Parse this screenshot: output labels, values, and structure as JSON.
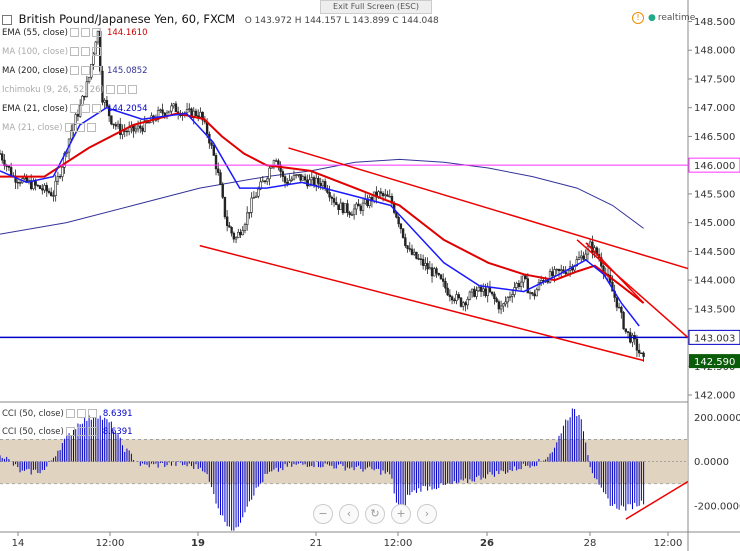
{
  "header": {
    "title": "British Pound/Japanese Yen, 60, FXCM",
    "ohlc": "O 143.972  H 144.157  L 143.899  C 144.048",
    "exit_label": "Exit Full Screen (ESC)",
    "realtime_label": "realtime"
  },
  "indicators": [
    {
      "label": "EMA (55, close)",
      "value": "144.1610",
      "color": "#cc0000"
    },
    {
      "label": "MA (100, close)",
      "value": "",
      "color": "#999999"
    },
    {
      "label": "MA (200, close)",
      "value": "145.0852",
      "color": "#333399"
    },
    {
      "label": "Ichimoku (9, 26, 52, 26)",
      "value": "",
      "color": "#aaaaaa"
    },
    {
      "label": "EMA (21, close)",
      "value": "144.2054",
      "color": "#0000cc"
    },
    {
      "label": "MA (21, close)",
      "value": "",
      "color": "#aaaaaa"
    }
  ],
  "cci_indicators": [
    {
      "label": "CCI (50, close)",
      "value": "8.6391"
    },
    {
      "label": "CCI (50, close)",
      "value": "8.6391"
    }
  ],
  "colors": {
    "candle": "#222222",
    "ema55": "#e00000",
    "ema21": "#1a1aff",
    "ma200": "#333399",
    "channel": "#ee0000",
    "hline_high": "#ff33ff",
    "hline_low": "#0000cc",
    "last_price_bg": "#0a5c0a",
    "cci": "#0000cc",
    "cci_band": "#d8c9b0"
  },
  "chart_data": [
    {
      "type": "candlestick",
      "ylim": [
        142.0,
        148.7
      ],
      "yticks": [
        "148.500",
        "148.000",
        "147.500",
        "147.000",
        "146.500",
        "146.000",
        "145.500",
        "145.000",
        "144.500",
        "144.000",
        "143.500",
        "143.000",
        "142.500",
        "142.000"
      ],
      "x_labels": [
        "14",
        "12:00",
        "19",
        "21",
        "12:00",
        "26",
        "28",
        "12:00"
      ],
      "price_labels": {
        "high_line": "146.000",
        "low_line": "143.003",
        "last": "142.590"
      },
      "horizontal_lines": [
        146.0,
        143.003
      ],
      "last_price": 142.59,
      "close_path": [
        [
          0,
          146.2
        ],
        [
          3,
          145.8
        ],
        [
          6,
          145.7
        ],
        [
          9,
          145.6
        ],
        [
          12,
          145.5
        ],
        [
          14,
          146.0
        ],
        [
          16,
          146.6
        ],
        [
          18,
          147.0
        ],
        [
          20,
          147.5
        ],
        [
          22,
          148.4
        ],
        [
          23,
          147.2
        ],
        [
          25,
          146.8
        ],
        [
          27,
          146.6
        ],
        [
          30,
          146.6
        ],
        [
          33,
          146.7
        ],
        [
          36,
          146.9
        ],
        [
          39,
          147.0
        ],
        [
          42,
          146.9
        ],
        [
          45,
          146.9
        ],
        [
          47,
          146.5
        ],
        [
          49,
          145.9
        ],
        [
          51,
          145.0
        ],
        [
          53,
          144.7
        ],
        [
          55,
          145.0
        ],
        [
          57,
          145.4
        ],
        [
          60,
          145.8
        ],
        [
          62,
          146.2
        ],
        [
          64,
          145.7
        ],
        [
          67,
          145.8
        ],
        [
          70,
          145.7
        ],
        [
          73,
          145.7
        ],
        [
          76,
          145.3
        ],
        [
          79,
          145.2
        ],
        [
          82,
          145.3
        ],
        [
          85,
          145.5
        ],
        [
          88,
          145.4
        ],
        [
          90,
          145.0
        ],
        [
          92,
          144.5
        ],
        [
          95,
          144.3
        ],
        [
          98,
          144.1
        ],
        [
          101,
          143.8
        ],
        [
          104,
          143.6
        ],
        [
          107,
          143.8
        ],
        [
          110,
          143.8
        ],
        [
          113,
          143.5
        ],
        [
          116,
          143.9
        ],
        [
          118,
          144.0
        ],
        [
          120,
          143.7
        ],
        [
          122,
          144.0
        ],
        [
          125,
          144.1
        ],
        [
          128,
          144.2
        ],
        [
          131,
          144.4
        ],
        [
          133,
          144.6
        ],
        [
          135,
          144.4
        ],
        [
          137,
          144.0
        ],
        [
          139,
          143.6
        ],
        [
          141,
          143.1
        ],
        [
          143,
          142.9
        ],
        [
          145,
          142.59
        ]
      ],
      "ema55": [
        [
          0,
          145.8
        ],
        [
          10,
          145.8
        ],
        [
          20,
          146.3
        ],
        [
          30,
          146.7
        ],
        [
          40,
          146.9
        ],
        [
          46,
          146.8
        ],
        [
          50,
          146.5
        ],
        [
          55,
          146.2
        ],
        [
          60,
          146.0
        ],
        [
          70,
          145.9
        ],
        [
          80,
          145.6
        ],
        [
          90,
          145.3
        ],
        [
          100,
          144.7
        ],
        [
          110,
          144.3
        ],
        [
          118,
          144.1
        ],
        [
          125,
          144.0
        ],
        [
          130,
          144.15
        ],
        [
          134,
          144.25
        ],
        [
          140,
          143.9
        ],
        [
          145,
          143.6
        ]
      ],
      "ema21": [
        [
          0,
          145.9
        ],
        [
          6,
          145.7
        ],
        [
          12,
          145.8
        ],
        [
          18,
          146.7
        ],
        [
          24,
          147.0
        ],
        [
          32,
          146.8
        ],
        [
          42,
          146.9
        ],
        [
          48,
          146.4
        ],
        [
          54,
          145.6
        ],
        [
          60,
          145.6
        ],
        [
          68,
          145.7
        ],
        [
          78,
          145.5
        ],
        [
          88,
          145.3
        ],
        [
          94,
          144.8
        ],
        [
          100,
          144.3
        ],
        [
          108,
          143.9
        ],
        [
          118,
          143.8
        ],
        [
          126,
          144.1
        ],
        [
          132,
          144.35
        ],
        [
          136,
          144.1
        ],
        [
          140,
          143.6
        ],
        [
          144,
          143.2
        ]
      ],
      "ma200": [
        [
          0,
          144.8
        ],
        [
          15,
          145.0
        ],
        [
          30,
          145.3
        ],
        [
          45,
          145.6
        ],
        [
          60,
          145.8
        ],
        [
          70,
          145.9
        ],
        [
          80,
          146.05
        ],
        [
          90,
          146.1
        ],
        [
          100,
          146.05
        ],
        [
          110,
          145.95
        ],
        [
          120,
          145.8
        ],
        [
          130,
          145.6
        ],
        [
          138,
          145.3
        ],
        [
          145,
          144.9
        ]
      ],
      "channel_lines": [
        {
          "from": [
            65,
            146.3
          ],
          "to": [
            155,
            144.2
          ]
        },
        {
          "from": [
            45,
            144.6
          ],
          "to": [
            145,
            142.6
          ]
        },
        {
          "from": [
            130,
            144.7
          ],
          "to": [
            155,
            143.0
          ]
        },
        {
          "from": [
            132,
            144.65
          ],
          "to": [
            145,
            143.6
          ]
        }
      ]
    },
    {
      "type": "bar",
      "name": "CCI (50, close)",
      "ylim": [
        -300,
        260
      ],
      "yticks": [
        "200.0000",
        "0.0000",
        "-200.0000"
      ],
      "band": [
        -100,
        100
      ],
      "values_path": [
        [
          0,
          40
        ],
        [
          5,
          -50
        ],
        [
          10,
          -40
        ],
        [
          14,
          80
        ],
        [
          18,
          180
        ],
        [
          22,
          210
        ],
        [
          25,
          170
        ],
        [
          28,
          60
        ],
        [
          32,
          -20
        ],
        [
          40,
          -10
        ],
        [
          46,
          -30
        ],
        [
          50,
          -250
        ],
        [
          53,
          -320
        ],
        [
          56,
          -180
        ],
        [
          60,
          -60
        ],
        [
          65,
          -20
        ],
        [
          70,
          -10
        ],
        [
          75,
          -20
        ],
        [
          80,
          -30
        ],
        [
          85,
          -40
        ],
        [
          88,
          -60
        ],
        [
          90,
          -250
        ],
        [
          92,
          -150
        ],
        [
          95,
          -120
        ],
        [
          100,
          -110
        ],
        [
          105,
          -90
        ],
        [
          110,
          -60
        ],
        [
          115,
          -40
        ],
        [
          118,
          -20
        ],
        [
          122,
          0
        ],
        [
          125,
          60
        ],
        [
          127,
          170
        ],
        [
          129,
          230
        ],
        [
          131,
          200
        ],
        [
          133,
          -20
        ],
        [
          135,
          -120
        ],
        [
          138,
          -200
        ],
        [
          141,
          -210
        ],
        [
          144,
          -190
        ],
        [
          145,
          -180
        ]
      ],
      "divergence_line": {
        "from": [
          141,
          -260
        ],
        "to": [
          155,
          -90
        ]
      }
    }
  ]
}
